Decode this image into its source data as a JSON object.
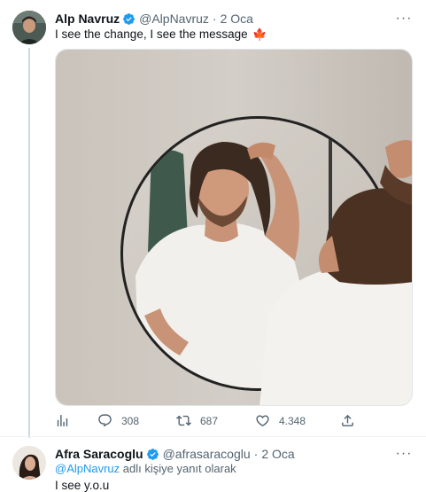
{
  "tweet": {
    "author_name": "Alp Navruz",
    "handle": "@AlpNavruz",
    "separator": "·",
    "date": "2 Oca",
    "text": "I see the change, I see the message",
    "flag_emoji": "🍁",
    "more": "···",
    "stats": {
      "replies": "308",
      "retweets": "687",
      "likes": "4.348"
    }
  },
  "reply": {
    "author_name": "Afra Saracoglu",
    "handle": "@afrasaracoglu",
    "separator": "·",
    "date": "2 Oca",
    "reply_mention": "@AlpNavruz",
    "reply_suffix": " adlı kişiye yanıt olarak",
    "text": "I see y.o.u",
    "more": "···"
  },
  "icons": [
    "verified-badge-icon",
    "more-icon",
    "analytics-icon",
    "reply-icon",
    "retweet-icon",
    "like-icon",
    "share-icon"
  ],
  "colors": {
    "verified": "#1d9bf0",
    "muted_text": "#536471",
    "primary_text": "#0f1419",
    "link": "#1d9bf0",
    "thread_line": "#cfd9de",
    "flag": "#d52b1e"
  }
}
